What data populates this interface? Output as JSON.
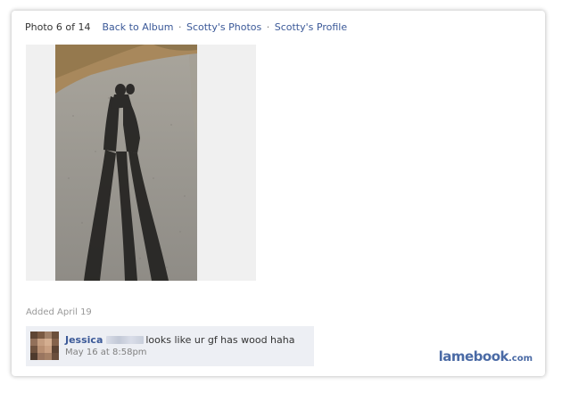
{
  "nav": {
    "photo_counter": "Photo 6 of 14",
    "back_to_album": "Back to Album",
    "separator": "·",
    "owner_photos": "Scotty's Photos",
    "owner_profile": "Scotty's Profile"
  },
  "photo": {
    "added_label": "Added April 19"
  },
  "comment": {
    "author": "Jessica",
    "text": "looks like ur gf has wood haha",
    "timestamp": "May 16 at 8:58pm"
  },
  "watermark": {
    "main": "lamebook",
    "suffix": ".com"
  },
  "colors": {
    "link": "#3b5998",
    "comment_bg": "#edeff4",
    "watermark": "#4a6aa5"
  }
}
